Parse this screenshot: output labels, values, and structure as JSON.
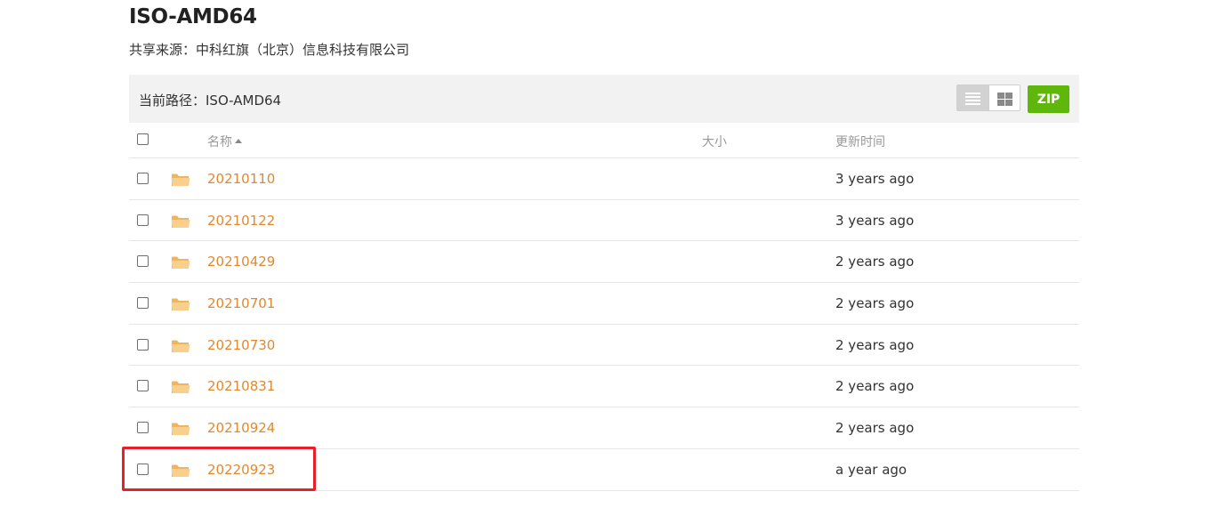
{
  "page": {
    "title": "ISO-AMD64",
    "share_source": "共享来源：中科红旗（北京）信息科技有限公司"
  },
  "toolbar": {
    "current_path": "当前路径：ISO-AMD64",
    "list_view_icon": "list-view-icon",
    "grid_view_icon": "grid-view-icon",
    "zip_label": "ZIP",
    "zip_color": "#5fb70c"
  },
  "table": {
    "headers": {
      "name": "名称",
      "size": "大小",
      "modified": "更新时间"
    },
    "sort": "name-ascending",
    "rows": [
      {
        "name": "20210110",
        "size": "",
        "modified": "3 years ago"
      },
      {
        "name": "20210122",
        "size": "",
        "modified": "3 years ago"
      },
      {
        "name": "20210429",
        "size": "",
        "modified": "2 years ago"
      },
      {
        "name": "20210701",
        "size": "",
        "modified": "2 years ago"
      },
      {
        "name": "20210730",
        "size": "",
        "modified": "2 years ago"
      },
      {
        "name": "20210831",
        "size": "",
        "modified": "2 years ago"
      },
      {
        "name": "20210924",
        "size": "",
        "modified": "2 years ago"
      },
      {
        "name": "20220923",
        "size": "",
        "modified": "a year ago"
      }
    ]
  },
  "colors": {
    "link": "#e0892e",
    "folder": "#f5c27a",
    "highlight": "#e8202a",
    "path_bar_bg": "#f2f2f2"
  }
}
